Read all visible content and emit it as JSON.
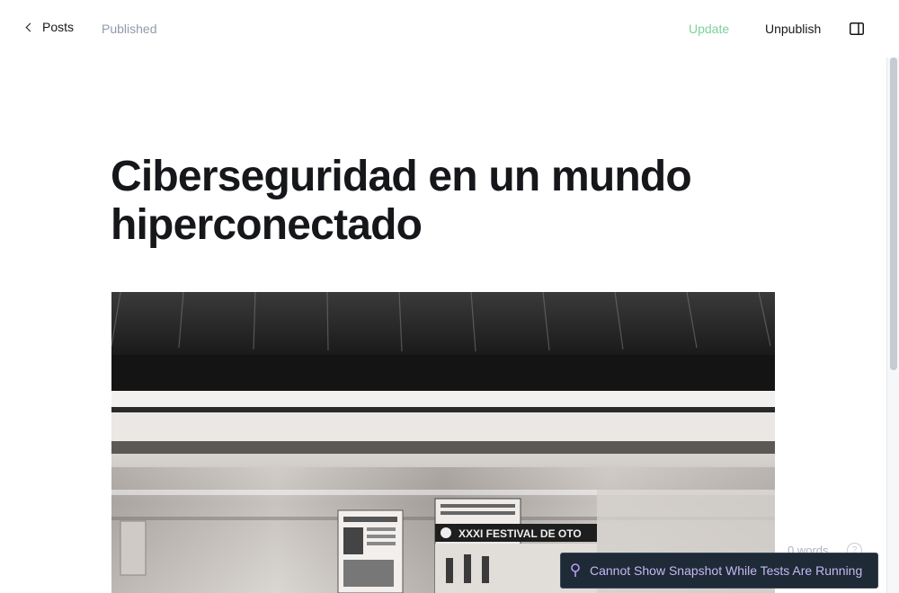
{
  "header": {
    "back_label": "Posts",
    "status": "Published",
    "update_label": "Update",
    "unpublish_label": "Unpublish",
    "sidebar_icon": "sidebar-toggle-icon"
  },
  "post": {
    "title": "Ciberseguridad en un mundo hiperconectado",
    "feature_image": {
      "poster_banner": "XXXI FESTIVAL DE OTO"
    }
  },
  "footer": {
    "word_count": "0 words",
    "help_symbol": "?"
  },
  "toast": {
    "message": "Cannot Show Snapshot While Tests Are Running",
    "icon": "pin-icon"
  },
  "colors": {
    "update": "#7dd19b",
    "status": "#8e9cac",
    "toast_bg": "#1e2a36",
    "toast_text": "#c7b7f2"
  }
}
